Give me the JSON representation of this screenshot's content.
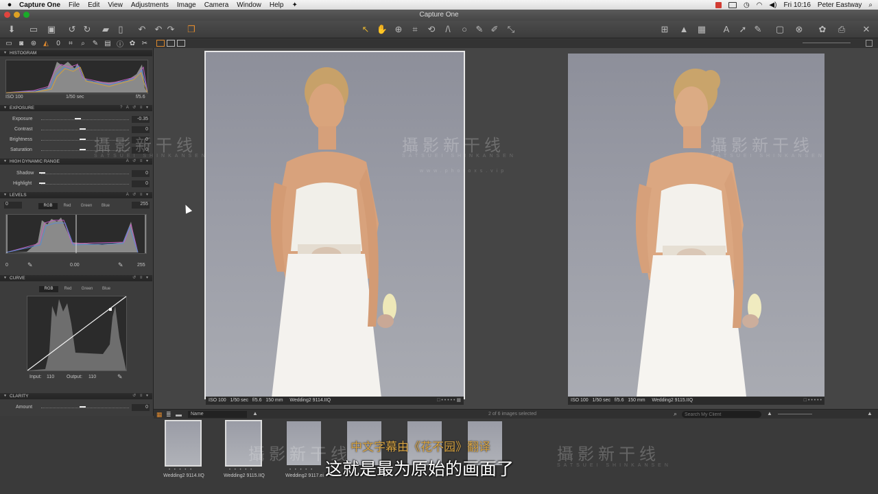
{
  "menubar": {
    "app": "Capture One",
    "items": [
      "File",
      "Edit",
      "View",
      "Adjustments",
      "Image",
      "Camera",
      "Window",
      "Help"
    ],
    "clock": "Fri 10:16",
    "user": "Peter Eastway"
  },
  "window": {
    "title": "Capture One"
  },
  "histogram": {
    "title": "HISTOGRAM",
    "iso": "ISO 100",
    "shutter": "1/50 sec",
    "aperture": "f/5.6"
  },
  "exposure": {
    "title": "EXPOSURE",
    "rows": [
      {
        "label": "Exposure",
        "value": "-0.35"
      },
      {
        "label": "Contrast",
        "value": "0"
      },
      {
        "label": "Brightness",
        "value": "0"
      },
      {
        "label": "Saturation",
        "value": "0"
      }
    ]
  },
  "hdr": {
    "title": "HIGH DYNAMIC RANGE",
    "rows": [
      {
        "label": "Shadow",
        "value": "0"
      },
      {
        "label": "Highlight",
        "value": "0"
      }
    ]
  },
  "levels": {
    "title": "LEVELS",
    "left_in": "0",
    "right_in": "255",
    "channels": [
      "RGB",
      "Red",
      "Green",
      "Blue"
    ],
    "left_out": "0",
    "mid": "0.00",
    "right_out": "255"
  },
  "curve": {
    "title": "CURVE",
    "channels": [
      "RGB",
      "Red",
      "Green",
      "Blue"
    ],
    "input_label": "Input:",
    "input_value": "110",
    "output_label": "Output:",
    "output_value": "110"
  },
  "clarity": {
    "title": "CLARITY",
    "rows": [
      {
        "label": "Amount",
        "value": "0"
      }
    ]
  },
  "viewer": {
    "left": {
      "iso": "ISO 100",
      "shutter": "1/50 sec",
      "aperture": "f/5.6",
      "focal": "150 mm",
      "file": "Wedding2 9114.IIQ"
    },
    "right": {
      "iso": "ISO 100",
      "shutter": "1/50 sec",
      "aperture": "f/5.6",
      "focal": "150 mm",
      "file": "Wedding2 9115.IIQ"
    }
  },
  "browser": {
    "sort": "Name",
    "count": "2 of 6 images selected",
    "search_placeholder": "Search My Client",
    "thumbs": [
      {
        "name": "Wedding2 9114.IIQ"
      },
      {
        "name": "Wedding2 9115.IIQ"
      },
      {
        "name": "Wedding2 9117.ei"
      },
      {
        "name": ""
      },
      {
        "name": ""
      },
      {
        "name": ""
      }
    ]
  },
  "overlay": {
    "watermark": "攝影新干线",
    "watermark_sub": "SATSUEI SHINKANSEN",
    "watermark_url": "www.photoxs.vip",
    "subtitle_credit": "中文字幕由《花不园》翻译",
    "subtitle_line": "这就是最为原始的画面了"
  },
  "colors": {
    "accent": "#e08a2e",
    "panel": "#3c3c3c",
    "viewer_bg": "#454545",
    "subtitle_credit": "#d8a442"
  },
  "icons": [
    "apple-icon",
    "import-icon",
    "rotate-left-icon",
    "rotate-right-icon",
    "cursor-icon",
    "pan-icon",
    "zoom-icon",
    "crop-icon",
    "straighten-icon",
    "picker-icon",
    "settings-icon",
    "print-icon",
    "search-icon"
  ]
}
